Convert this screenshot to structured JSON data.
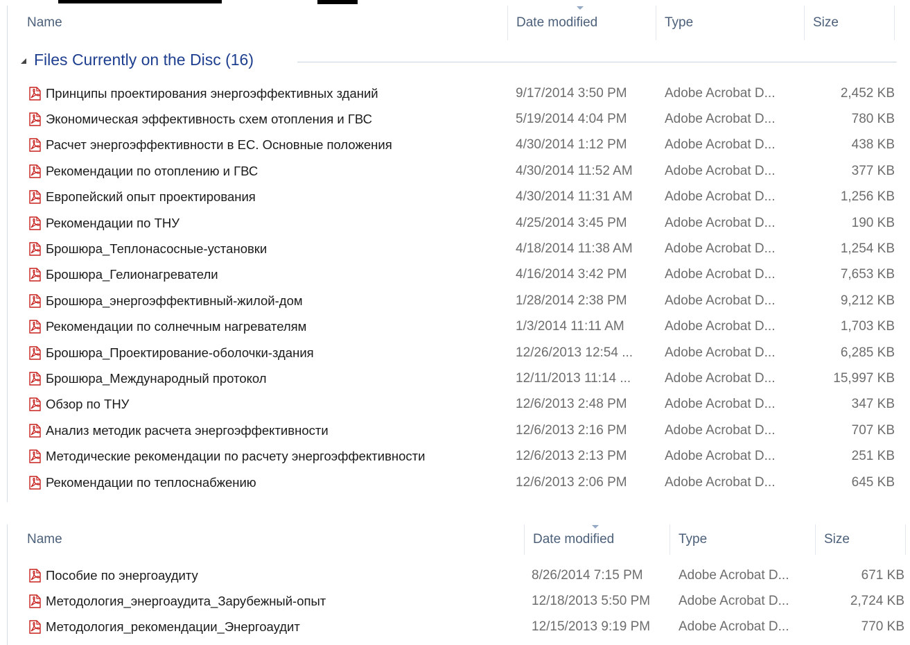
{
  "columns": {
    "name": "Name",
    "date": "Date modified",
    "type": "Type",
    "size": "Size"
  },
  "group": {
    "label": "Files Currently on the Disc (16)"
  },
  "files_top": [
    {
      "name": "Принципы проектирования энергоэффективных зданий",
      "date": "9/17/2014 3:50 PM",
      "type": "Adobe Acrobat D...",
      "size": "2,452 KB"
    },
    {
      "name": "Экономическая эффективность схем отопления и ГВС",
      "date": "5/19/2014 4:04 PM",
      "type": "Adobe Acrobat D...",
      "size": "780 KB"
    },
    {
      "name": "Расчет энергоэффективности в ЕС. Основные положения",
      "date": "4/30/2014 1:12 PM",
      "type": "Adobe Acrobat D...",
      "size": "438 KB"
    },
    {
      "name": "Рекомендации по отоплению и ГВС",
      "date": "4/30/2014 11:52 AM",
      "type": "Adobe Acrobat D...",
      "size": "377 KB"
    },
    {
      "name": "Европейский опыт проектирования",
      "date": "4/30/2014 11:31 AM",
      "type": "Adobe Acrobat D...",
      "size": "1,256 KB"
    },
    {
      "name": "Рекомендации по ТНУ",
      "date": "4/25/2014 3:45 PM",
      "type": "Adobe Acrobat D...",
      "size": "190 KB"
    },
    {
      "name": "Брошюра_Теплонасосные-установки",
      "date": "4/18/2014 11:38 AM",
      "type": "Adobe Acrobat D...",
      "size": "1,254 KB"
    },
    {
      "name": "Брошюра_Гелионагреватели",
      "date": "4/16/2014 3:42 PM",
      "type": "Adobe Acrobat D...",
      "size": "7,653 KB"
    },
    {
      "name": "Брошюра_энергоэффективный-жилой-дом",
      "date": "1/28/2014 2:38 PM",
      "type": "Adobe Acrobat D...",
      "size": "9,212 KB"
    },
    {
      "name": "Рекомендации по солнечным нагревателям",
      "date": "1/3/2014 11:11 AM",
      "type": "Adobe Acrobat D...",
      "size": "1,703 KB"
    },
    {
      "name": "Брошюра_Проектирование-оболочки-здания",
      "date": "12/26/2013 12:54 ...",
      "type": "Adobe Acrobat D...",
      "size": "6,285 KB"
    },
    {
      "name": "Брошюра_Международный протокол",
      "date": "12/11/2013 11:14 ...",
      "type": "Adobe Acrobat D...",
      "size": "15,997 KB"
    },
    {
      "name": "Обзор по ТНУ",
      "date": "12/6/2013 2:48 PM",
      "type": "Adobe Acrobat D...",
      "size": "347 KB"
    },
    {
      "name": "Анализ методик расчета энергоэффективности",
      "date": "12/6/2013 2:16 PM",
      "type": "Adobe Acrobat D...",
      "size": "707 KB"
    },
    {
      "name": "Методические рекомендации по расчету энергоэффективности",
      "date": "12/6/2013 2:13 PM",
      "type": "Adobe Acrobat D...",
      "size": "251 KB"
    },
    {
      "name": "Рекомендации по теплоснабжению",
      "date": "12/6/2013 2:06 PM",
      "type": "Adobe Acrobat D...",
      "size": "645 KB"
    }
  ],
  "files_bottom": [
    {
      "name": "Пособие по энергоаудиту",
      "date": "8/26/2014 7:15 PM",
      "type": "Adobe Acrobat D...",
      "size": "671 KB"
    },
    {
      "name": "Методология_энергоаудита_Зарубежный-опыт",
      "date": "12/18/2013 5:50 PM",
      "type": "Adobe Acrobat D...",
      "size": "2,724 KB"
    },
    {
      "name": "Методология_рекомендации_Энергоаудит",
      "date": "12/15/2013 9:19 PM",
      "type": "Adobe Acrobat D...",
      "size": "770 KB"
    }
  ],
  "icons": {
    "file": "pdf-file-icon",
    "sort": "sort-descending-icon",
    "group": "collapse-triangle-icon"
  },
  "colors": {
    "header_text": "#4c607a",
    "group_text": "#1e3e8f",
    "detail_text": "#6d6d6d",
    "pdf_red": "#c8201d"
  }
}
